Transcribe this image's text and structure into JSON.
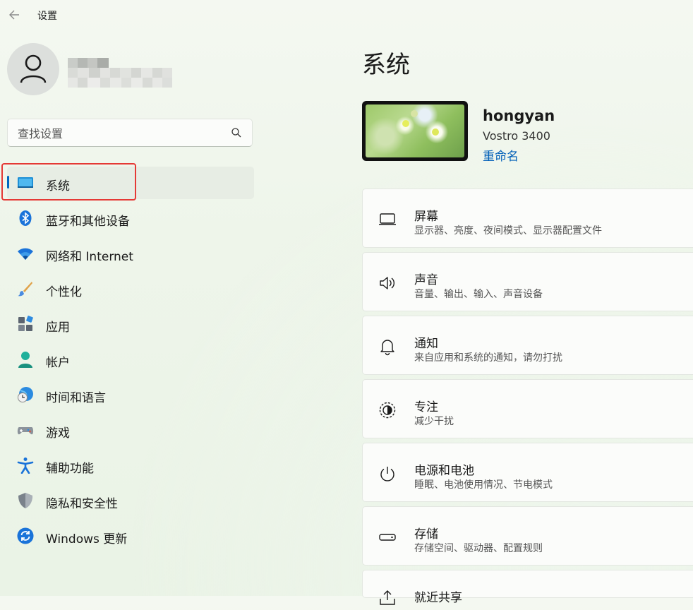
{
  "titlebar": {
    "title": "设置"
  },
  "search": {
    "placeholder": "查找设置"
  },
  "nav": [
    {
      "label": "系统",
      "icon": "system-icon"
    },
    {
      "label": "蓝牙和其他设备",
      "icon": "bluetooth-icon"
    },
    {
      "label": "网络和 Internet",
      "icon": "wifi-icon"
    },
    {
      "label": "个性化",
      "icon": "brush-icon"
    },
    {
      "label": "应用",
      "icon": "apps-icon"
    },
    {
      "label": "帐户",
      "icon": "account-icon"
    },
    {
      "label": "时间和语言",
      "icon": "globe-clock-icon"
    },
    {
      "label": "游戏",
      "icon": "gamepad-icon"
    },
    {
      "label": "辅助功能",
      "icon": "accessibility-icon"
    },
    {
      "label": "隐私和安全性",
      "icon": "shield-icon"
    },
    {
      "label": "Windows 更新",
      "icon": "update-icon"
    }
  ],
  "main": {
    "title": "系统",
    "device": {
      "name": "hongyan",
      "model": "Vostro 3400",
      "rename": "重命名"
    },
    "cards": [
      {
        "title": "屏幕",
        "subtitle": "显示器、亮度、夜间模式、显示器配置文件",
        "icon": "monitor-icon"
      },
      {
        "title": "声音",
        "subtitle": "音量、输出、输入、声音设备",
        "icon": "speaker-icon"
      },
      {
        "title": "通知",
        "subtitle": "来自应用和系统的通知，请勿打扰",
        "icon": "bell-icon"
      },
      {
        "title": "专注",
        "subtitle": "减少干扰",
        "icon": "focus-icon"
      },
      {
        "title": "电源和电池",
        "subtitle": "睡眠、电池使用情况、节电模式",
        "icon": "power-icon"
      },
      {
        "title": "存储",
        "subtitle": "存储空间、驱动器、配置规则",
        "icon": "storage-icon"
      },
      {
        "title": "就近共享",
        "subtitle": "",
        "icon": "share-icon"
      }
    ]
  },
  "colors": {
    "accent": "#0067c0",
    "highlight": "#e53935"
  }
}
